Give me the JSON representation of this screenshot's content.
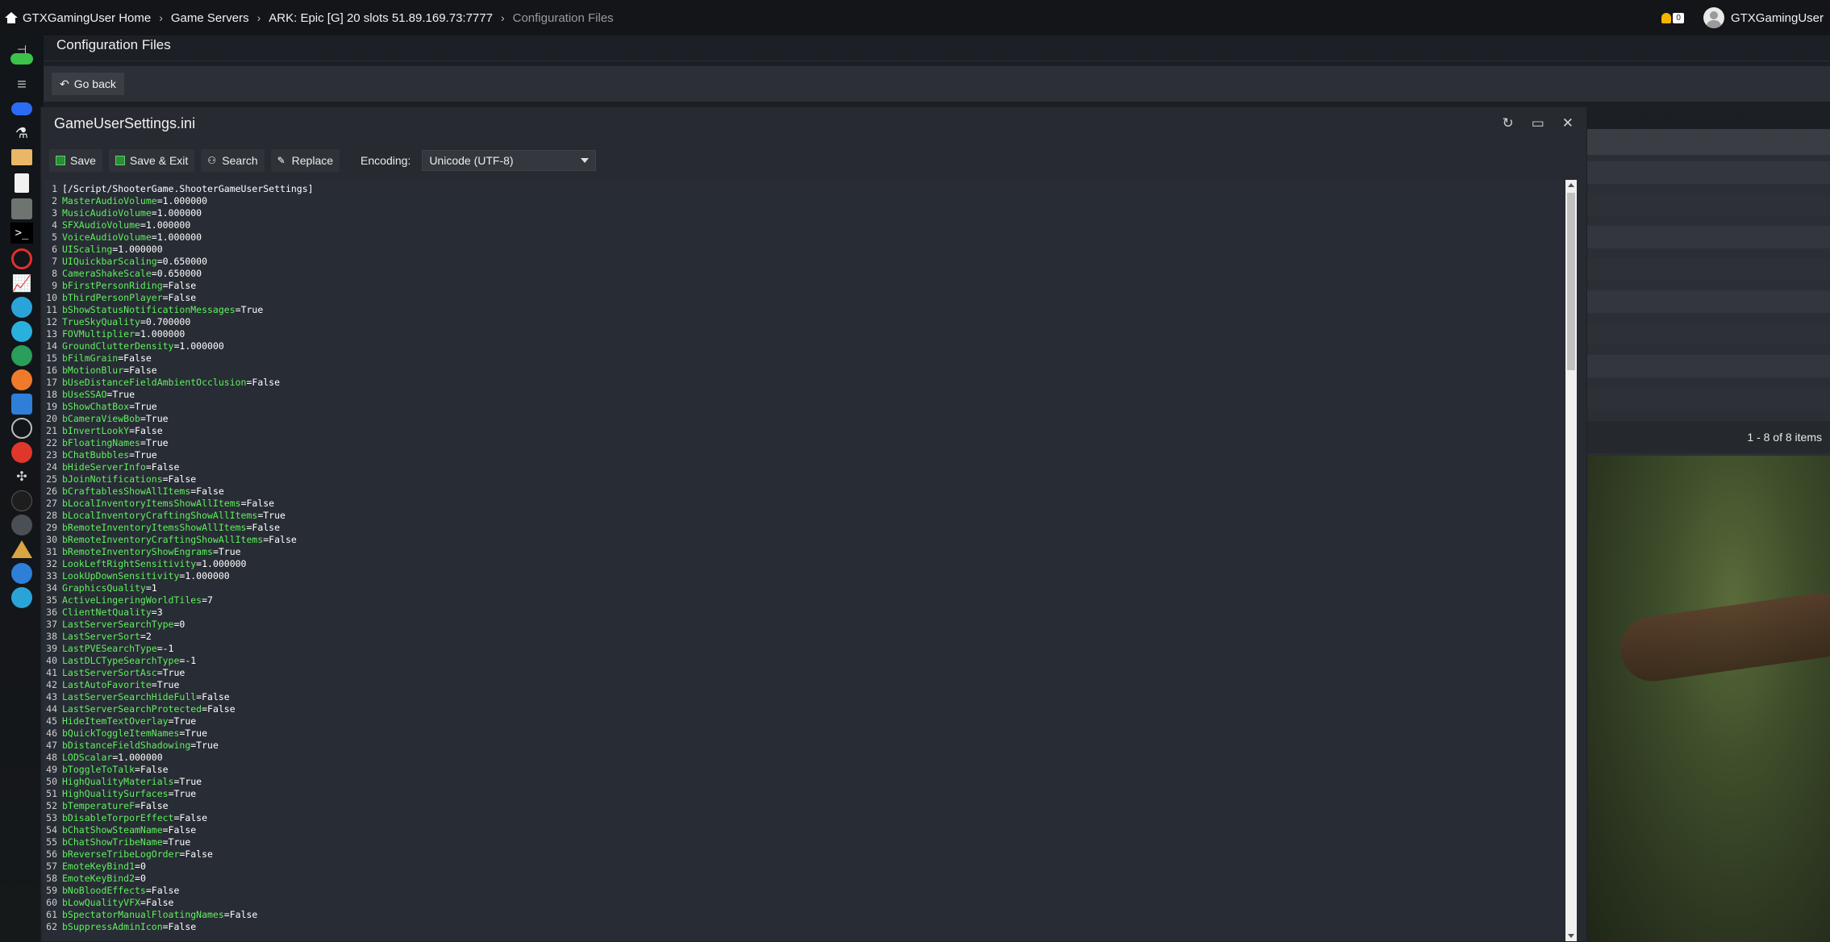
{
  "breadcrumb": {
    "home": "GTXGamingUser Home",
    "game_servers": "Game Servers",
    "server": "ARK: Epic [G] 20 slots 51.89.169.73:7777",
    "current": "Configuration Files"
  },
  "notifications": {
    "count": "0"
  },
  "user": {
    "name": "GTXGamingUser"
  },
  "page": {
    "title": "Configuration Files",
    "go_back": "Go back"
  },
  "pager": {
    "text": "1 - 8 of 8 items"
  },
  "modal": {
    "title": "GameUserSettings.ini",
    "toolbar": {
      "save": "Save",
      "save_exit": "Save & Exit",
      "search": "Search",
      "replace": "Replace",
      "encoding_label": "Encoding:",
      "encoding_value": "Unicode (UTF-8)"
    }
  },
  "editor": {
    "lines": [
      {
        "n": "1",
        "k": "[/Script/ShooterGame.ShooterGameUserSettings]",
        "v": "",
        "section": true
      },
      {
        "n": "2",
        "k": "MasterAudioVolume",
        "v": "=1.000000"
      },
      {
        "n": "3",
        "k": "MusicAudioVolume",
        "v": "=1.000000"
      },
      {
        "n": "4",
        "k": "SFXAudioVolume",
        "v": "=1.000000"
      },
      {
        "n": "5",
        "k": "VoiceAudioVolume",
        "v": "=1.000000"
      },
      {
        "n": "6",
        "k": "UIScaling",
        "v": "=1.000000"
      },
      {
        "n": "7",
        "k": "UIQuickbarScaling",
        "v": "=0.650000"
      },
      {
        "n": "8",
        "k": "CameraShakeScale",
        "v": "=0.650000"
      },
      {
        "n": "9",
        "k": "bFirstPersonRiding",
        "v": "=False"
      },
      {
        "n": "10",
        "k": "bThirdPersonPlayer",
        "v": "=False"
      },
      {
        "n": "11",
        "k": "bShowStatusNotificationMessages",
        "v": "=True"
      },
      {
        "n": "12",
        "k": "TrueSkyQuality",
        "v": "=0.700000"
      },
      {
        "n": "13",
        "k": "FOVMultiplier",
        "v": "=1.000000"
      },
      {
        "n": "14",
        "k": "GroundClutterDensity",
        "v": "=1.000000"
      },
      {
        "n": "15",
        "k": "bFilmGrain",
        "v": "=False"
      },
      {
        "n": "16",
        "k": "bMotionBlur",
        "v": "=False"
      },
      {
        "n": "17",
        "k": "bUseDistanceFieldAmbientOcclusion",
        "v": "=False"
      },
      {
        "n": "18",
        "k": "bUseSSAO",
        "v": "=True"
      },
      {
        "n": "19",
        "k": "bShowChatBox",
        "v": "=True"
      },
      {
        "n": "20",
        "k": "bCameraViewBob",
        "v": "=True"
      },
      {
        "n": "21",
        "k": "bInvertLookY",
        "v": "=False"
      },
      {
        "n": "22",
        "k": "bFloatingNames",
        "v": "=True"
      },
      {
        "n": "23",
        "k": "bChatBubbles",
        "v": "=True"
      },
      {
        "n": "24",
        "k": "bHideServerInfo",
        "v": "=False"
      },
      {
        "n": "25",
        "k": "bJoinNotifications",
        "v": "=False"
      },
      {
        "n": "26",
        "k": "bCraftablesShowAllItems",
        "v": "=False"
      },
      {
        "n": "27",
        "k": "bLocalInventoryItemsShowAllItems",
        "v": "=False"
      },
      {
        "n": "28",
        "k": "bLocalInventoryCraftingShowAllItems",
        "v": "=True"
      },
      {
        "n": "29",
        "k": "bRemoteInventoryItemsShowAllItems",
        "v": "=False"
      },
      {
        "n": "30",
        "k": "bRemoteInventoryCraftingShowAllItems",
        "v": "=False"
      },
      {
        "n": "31",
        "k": "bRemoteInventoryShowEngrams",
        "v": "=True"
      },
      {
        "n": "32",
        "k": "LookLeftRightSensitivity",
        "v": "=1.000000"
      },
      {
        "n": "33",
        "k": "LookUpDownSensitivity",
        "v": "=1.000000"
      },
      {
        "n": "34",
        "k": "GraphicsQuality",
        "v": "=1"
      },
      {
        "n": "35",
        "k": "ActiveLingeringWorldTiles",
        "v": "=7"
      },
      {
        "n": "36",
        "k": "ClientNetQuality",
        "v": "=3"
      },
      {
        "n": "37",
        "k": "LastServerSearchType",
        "v": "=0"
      },
      {
        "n": "38",
        "k": "LastServerSort",
        "v": "=2"
      },
      {
        "n": "39",
        "k": "LastPVESearchType",
        "v": "=-1"
      },
      {
        "n": "40",
        "k": "LastDLCTypeSearchType",
        "v": "=-1"
      },
      {
        "n": "41",
        "k": "LastServerSortAsc",
        "v": "=True"
      },
      {
        "n": "42",
        "k": "LastAutoFavorite",
        "v": "=True"
      },
      {
        "n": "43",
        "k": "LastServerSearchHideFull",
        "v": "=False"
      },
      {
        "n": "44",
        "k": "LastServerSearchProtected",
        "v": "=False"
      },
      {
        "n": "45",
        "k": "HideItemTextOverlay",
        "v": "=True"
      },
      {
        "n": "46",
        "k": "bQuickToggleItemNames",
        "v": "=True"
      },
      {
        "n": "47",
        "k": "bDistanceFieldShadowing",
        "v": "=True"
      },
      {
        "n": "48",
        "k": "LODScalar",
        "v": "=1.000000"
      },
      {
        "n": "49",
        "k": "bToggleToTalk",
        "v": "=False"
      },
      {
        "n": "50",
        "k": "HighQualityMaterials",
        "v": "=True"
      },
      {
        "n": "51",
        "k": "HighQualitySurfaces",
        "v": "=True"
      },
      {
        "n": "52",
        "k": "bTemperatureF",
        "v": "=False"
      },
      {
        "n": "53",
        "k": "bDisableTorporEffect",
        "v": "=False"
      },
      {
        "n": "54",
        "k": "bChatShowSteamName",
        "v": "=False"
      },
      {
        "n": "55",
        "k": "bChatShowTribeName",
        "v": "=True"
      },
      {
        "n": "56",
        "k": "bReverseTribeLogOrder",
        "v": "=False"
      },
      {
        "n": "57",
        "k": "EmoteKeyBind1",
        "v": "=0"
      },
      {
        "n": "58",
        "k": "EmoteKeyBind2",
        "v": "=0"
      },
      {
        "n": "59",
        "k": "bNoBloodEffects",
        "v": "=False"
      },
      {
        "n": "60",
        "k": "bLowQualityVFX",
        "v": "=False"
      },
      {
        "n": "61",
        "k": "bSpectatorManualFloatingNames",
        "v": "=False"
      },
      {
        "n": "62",
        "k": "bSuppressAdminIcon",
        "v": "=False"
      }
    ]
  },
  "colors": {
    "key_green": "#5ff05f",
    "editor_bg": "#282c34",
    "bell": "#f5b400"
  },
  "sidebar": {
    "icons": [
      "pin-icon",
      "gamepad-icon",
      "sliders-icon",
      "cloud-download-icon",
      "flask-icon",
      "folder-icon",
      "file-chart-icon",
      "steam-icon",
      "terminal-icon",
      "clock-icon",
      "chart-line-icon",
      "app-icon-1",
      "app-icon-2",
      "app-icon-3",
      "app-icon-4",
      "document-icon",
      "map-icon",
      "app-icon-5",
      "mod-icon-1",
      "mod-icon-2",
      "ark-icon",
      "ark-survival-icon",
      "book-icon",
      "support-icon"
    ]
  }
}
